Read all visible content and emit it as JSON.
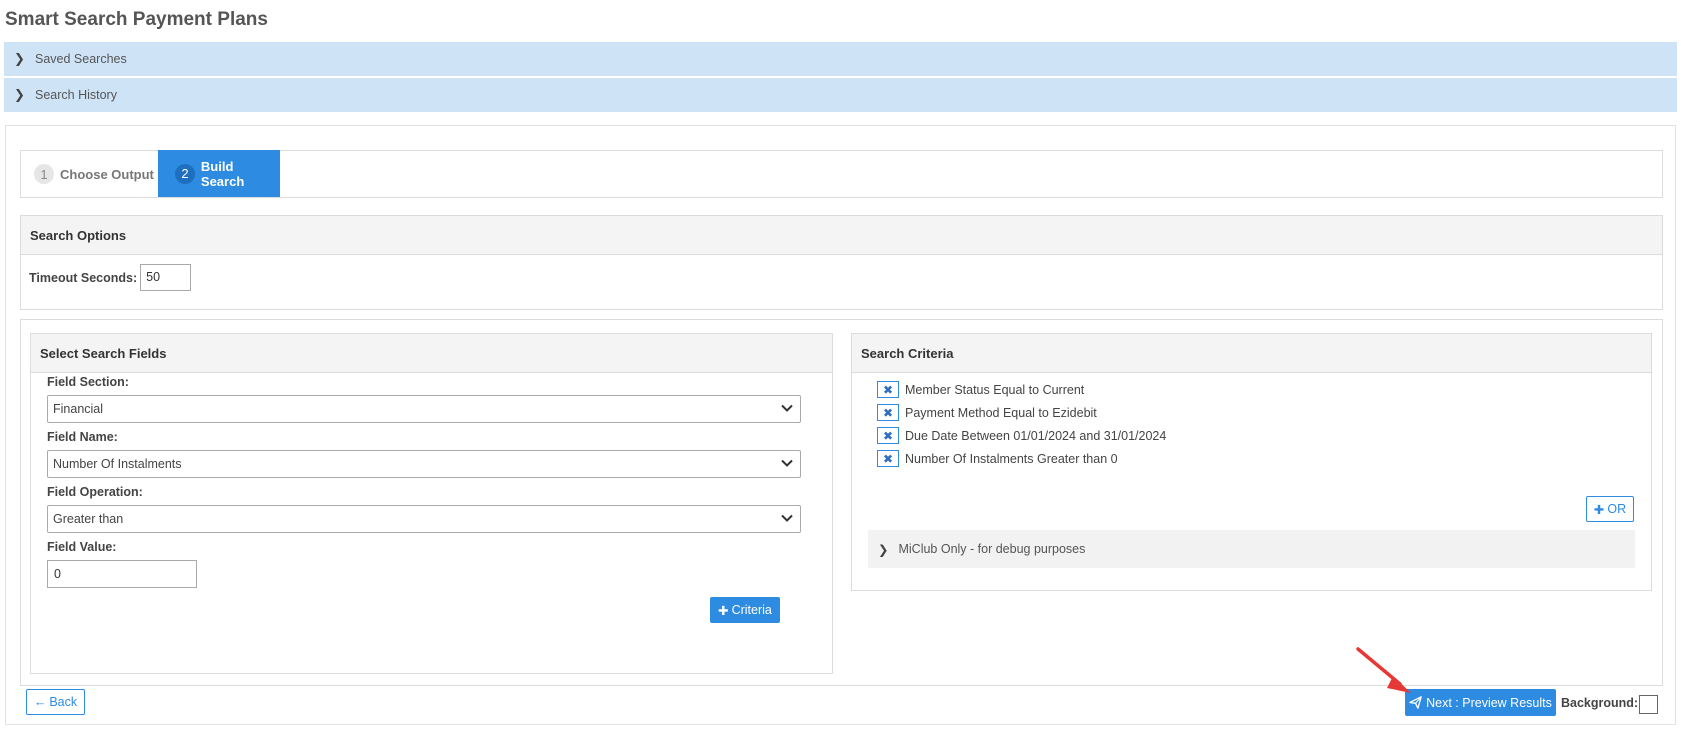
{
  "page": {
    "title": "Smart Search Payment Plans"
  },
  "accordions": [
    {
      "label": "Saved Searches"
    },
    {
      "label": "Search History"
    }
  ],
  "steps": [
    {
      "num": "1",
      "label": "Choose Output"
    },
    {
      "num": "2",
      "label": "Build Search"
    }
  ],
  "search_options": {
    "title": "Search Options",
    "timeout_label": "Timeout Seconds:",
    "timeout_value": "50"
  },
  "select_fields": {
    "title": "Select Search Fields",
    "section_label": "Field Section:",
    "section_value": "Financial",
    "name_label": "Field Name:",
    "name_value": "Number Of Instalments",
    "operation_label": "Field Operation:",
    "operation_value": "Greater than",
    "value_label": "Field Value:",
    "value_value": "0",
    "criteria_button": "Criteria"
  },
  "search_criteria": {
    "title": "Search Criteria",
    "items": [
      "Member Status Equal to Current",
      "Payment Method Equal to Ezidebit",
      "Due Date Between 01/01/2024 and 31/01/2024",
      "Number Of Instalments Greater than 0"
    ],
    "or_button": "OR",
    "debug_label": "MiClub Only - for debug purposes"
  },
  "footer": {
    "back_button": "Back",
    "next_button": "Next : Preview Results",
    "background_label": "Background:"
  },
  "colors": {
    "accent": "#2e8be2",
    "accordion_bg": "#cfe3f7",
    "annotation_arrow": "#e53935"
  }
}
